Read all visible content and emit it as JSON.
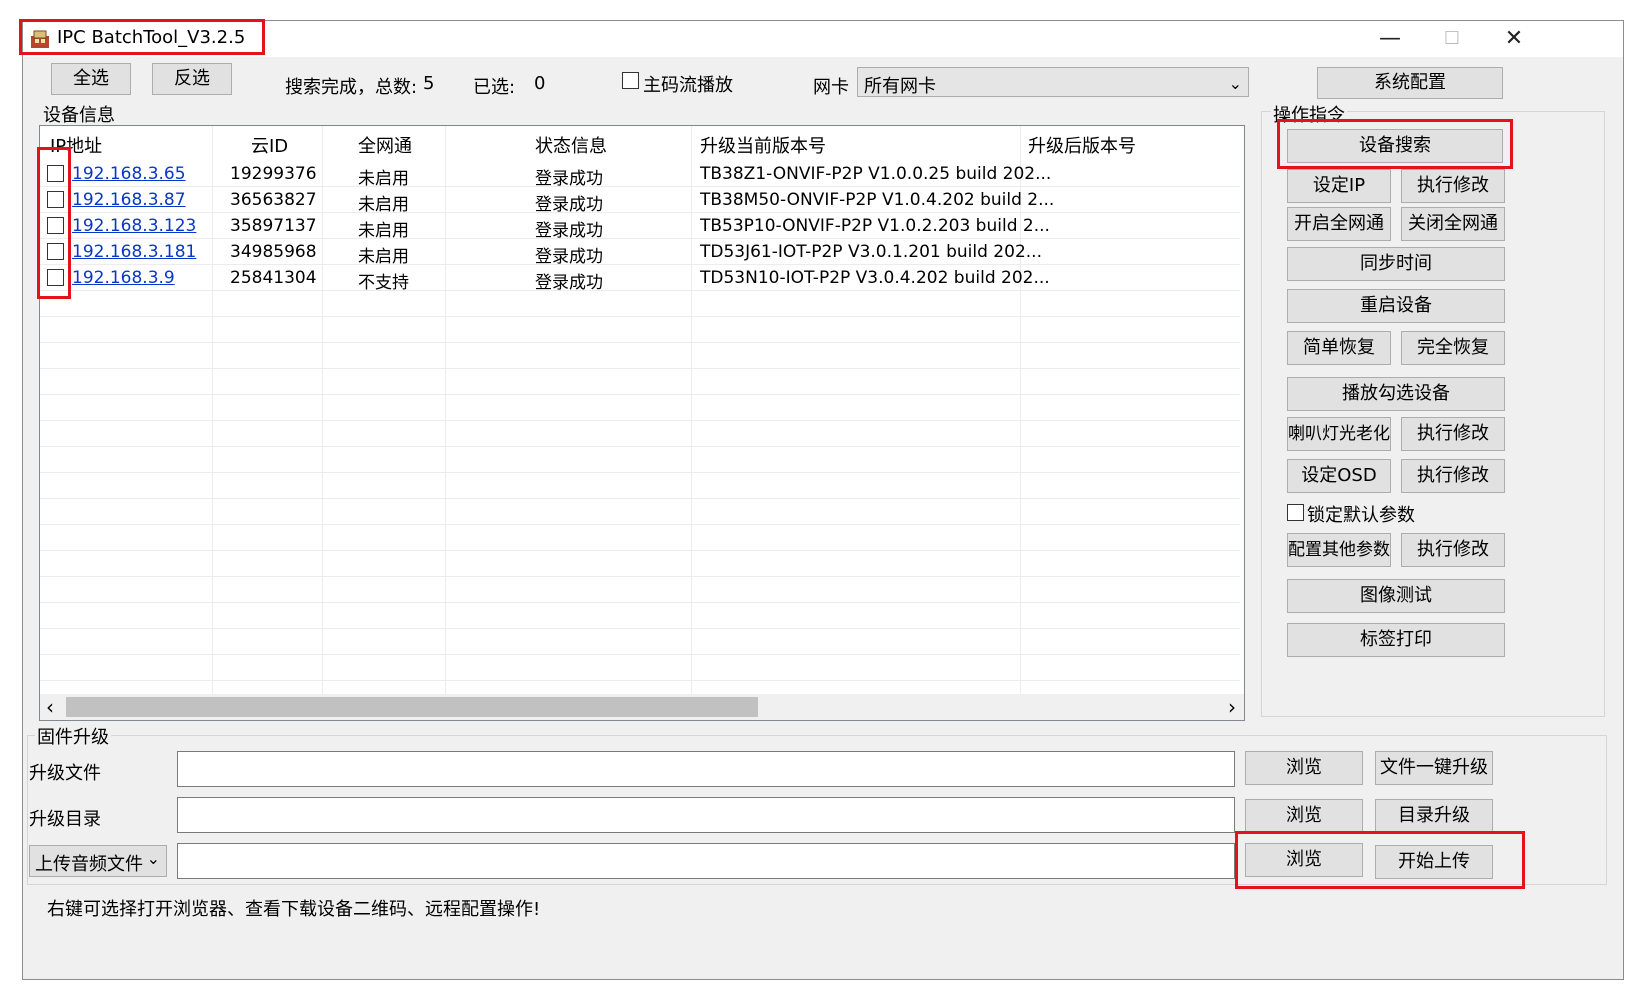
{
  "window": {
    "title": "IPC BatchTool_V3.2.5",
    "minimize": "—",
    "maximize": "☐",
    "close": "✕"
  },
  "toolbar": {
    "select_all": "全选",
    "invert_select": "反选",
    "search_status": "搜索完成，总数:",
    "total_count": "5",
    "selected_label": "已选:",
    "selected_count": "0",
    "main_stream_label": "主码流播放",
    "nic_label": "网卡",
    "nic_value": "所有网卡",
    "system_config": "系统配置"
  },
  "device_info": {
    "group_title": "设备信息",
    "columns": [
      "IP地址",
      "云ID",
      "全网通",
      "状态信息",
      "升级当前版本号",
      "升级后版本号"
    ],
    "rows": [
      {
        "ip": "192.168.3.65",
        "cloud_id": "19299376",
        "all_net": "未启用",
        "status": "登录成功",
        "current_version": "TB38Z1-ONVIF-P2P V1.0.0.25 build 202...",
        "upgraded_version": ""
      },
      {
        "ip": "192.168.3.87",
        "cloud_id": "36563827",
        "all_net": "未启用",
        "status": "登录成功",
        "current_version": "TB38M50-ONVIF-P2P V1.0.4.202 build 2...",
        "upgraded_version": ""
      },
      {
        "ip": "192.168.3.123",
        "cloud_id": "35897137",
        "all_net": "未启用",
        "status": "登录成功",
        "current_version": "TB53P10-ONVIF-P2P V1.0.2.203 build 2...",
        "upgraded_version": ""
      },
      {
        "ip": "192.168.3.181",
        "cloud_id": "34985968",
        "all_net": "未启用",
        "status": "登录成功",
        "current_version": "TD53J61-IOT-P2P V3.0.1.201 build 202...",
        "upgraded_version": ""
      },
      {
        "ip": "192.168.3.9",
        "cloud_id": "25841304",
        "all_net": "不支持",
        "status": "登录成功",
        "current_version": "TD53N10-IOT-P2P V3.0.4.202 build 202...",
        "upgraded_version": ""
      }
    ],
    "scroll_left": "‹",
    "scroll_right": "›"
  },
  "operations": {
    "group_title": "操作指令",
    "device_search": "设备搜索",
    "set_ip": "设定IP",
    "execute_modify": "执行修改",
    "enable_all_net": "开启全网通",
    "disable_all_net": "关闭全网通",
    "sync_time": "同步时间",
    "reboot": "重启设备",
    "simple_restore": "简单恢复",
    "full_restore": "完全恢复",
    "play_selected": "播放勾选设备",
    "speaker_light_aging": "喇叭灯光老化",
    "set_osd": "设定OSD",
    "lock_defaults": "锁定默认参数",
    "config_other": "配置其他参数",
    "image_test": "图像测试",
    "label_print": "标签打印"
  },
  "firmware": {
    "group_title": "固件升级",
    "upgrade_file_label": "升级文件",
    "upgrade_dir_label": "升级目录",
    "upload_type_value": "上传音频文件",
    "upload_type_arrow": "⌄",
    "browse": "浏览",
    "one_click_upgrade": "文件一键升级",
    "dir_upgrade": "目录升级",
    "start_upload": "开始上传"
  },
  "status_bar": {
    "hint": "右键可选择打开浏览器、查看下载设备二维码、远程配置操作!"
  },
  "colors": {
    "highlight": "#e3121b",
    "link": "#0a36c7",
    "window_bg": "#f0f0f0"
  }
}
